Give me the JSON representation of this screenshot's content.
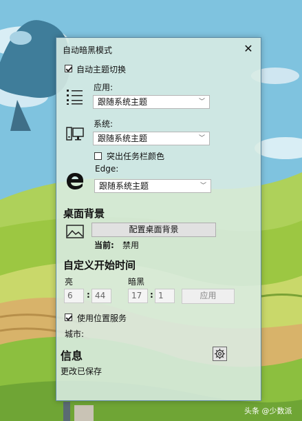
{
  "window": {
    "title": "自动暗黑模式"
  },
  "auto_theme": {
    "label": "自动主题切换",
    "checked": true
  },
  "apps": {
    "label": "应用:",
    "value": "跟随系统主题",
    "icon": "list-icon"
  },
  "system": {
    "label": "系统:",
    "value": "跟随系统主题",
    "icon": "monitor-icon"
  },
  "taskbar_color": {
    "label": "突出任务栏颜色",
    "checked": false
  },
  "edge": {
    "label": "Edge:",
    "value": "跟随系统主题",
    "icon": "edge-icon"
  },
  "desktop": {
    "heading": "桌面背景",
    "button": "配置桌面背景",
    "current_label": "当前:",
    "current_value": "禁用",
    "icon": "picture-icon"
  },
  "custom_time": {
    "heading": "自定义开始时间",
    "light_label": "亮",
    "light_hour": "6",
    "light_minute": "44",
    "dark_label": "暗黑",
    "dark_hour": "17",
    "dark_minute": "1",
    "apply_button": "应用",
    "colon": ":"
  },
  "location": {
    "label": "使用位置服务",
    "checked": true,
    "city_label": "城市:"
  },
  "info": {
    "heading": "信息",
    "status": "更改已保存",
    "icon": "settings-icon"
  },
  "watermark": "头条 @少数派",
  "colors": {
    "window_bg": "#daece4",
    "border": "#5e8aa3",
    "sky": "#7fc3df",
    "grass": "#9cc742"
  }
}
